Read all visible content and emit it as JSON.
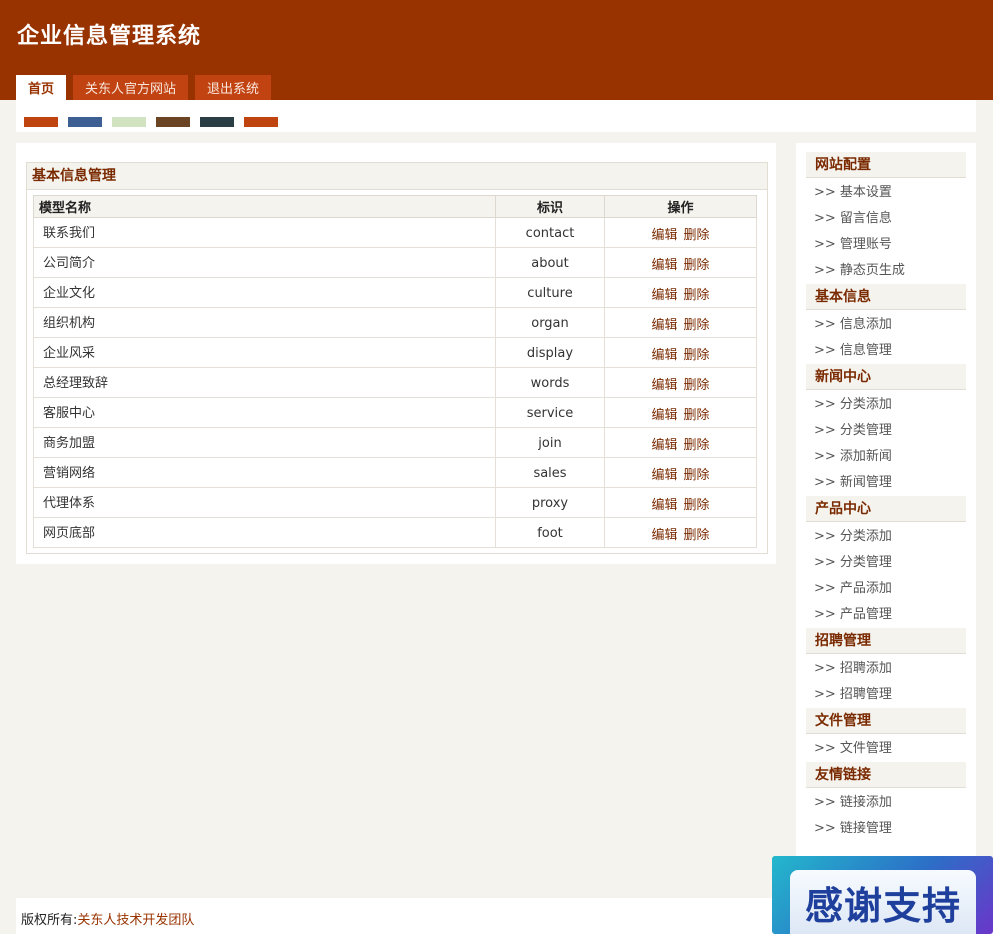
{
  "app": {
    "title": "企业信息管理系统"
  },
  "nav_tabs": [
    {
      "label": "首页",
      "active": true
    },
    {
      "label": "关东人官方网站",
      "active": false
    },
    {
      "label": "退出系统",
      "active": false
    }
  ],
  "theme_swatches": [
    "#c0440f",
    "#3e5f93",
    "#d2e3c2",
    "#6b4423",
    "#2b3e45",
    "#c0440f"
  ],
  "main": {
    "section_title": "基本信息管理",
    "table": {
      "headers": [
        "模型名称",
        "标识",
        "操作"
      ],
      "rows": [
        {
          "name": "联系我们",
          "id": "contact"
        },
        {
          "name": "公司简介",
          "id": "about"
        },
        {
          "name": "企业文化",
          "id": "culture"
        },
        {
          "name": "组织机构",
          "id": "organ"
        },
        {
          "name": "企业风采",
          "id": "display"
        },
        {
          "name": "总经理致辞",
          "id": "words"
        },
        {
          "name": "客服中心",
          "id": "service"
        },
        {
          "name": "商务加盟",
          "id": "join"
        },
        {
          "name": "营销网络",
          "id": "sales"
        },
        {
          "name": "代理体系",
          "id": "proxy"
        },
        {
          "name": "网页底部",
          "id": "foot"
        }
      ],
      "edit_label": "编辑",
      "delete_label": "删除"
    }
  },
  "sidebar": {
    "groups": [
      {
        "title": "网站配置",
        "items": [
          ">> 基本设置",
          ">> 留言信息",
          ">> 管理账号",
          ">> 静态页生成"
        ]
      },
      {
        "title": "基本信息",
        "items": [
          ">> 信息添加",
          ">> 信息管理"
        ]
      },
      {
        "title": "新闻中心",
        "items": [
          ">> 分类添加",
          ">> 分类管理",
          ">> 添加新闻",
          ">> 新闻管理"
        ]
      },
      {
        "title": "产品中心",
        "items": [
          ">> 分类添加",
          ">> 分类管理",
          ">> 产品添加",
          ">> 产品管理"
        ]
      },
      {
        "title": "招聘管理",
        "items": [
          ">> 招聘添加",
          ">> 招聘管理"
        ]
      },
      {
        "title": "文件管理",
        "items": [
          ">> 文件管理"
        ]
      },
      {
        "title": "友情链接",
        "items": [
          ">> 链接添加",
          ">> 链接管理"
        ]
      }
    ]
  },
  "footer": {
    "copyright_prefix": "版权所有:",
    "team": "关东人技术开发团队"
  },
  "badge": {
    "text": "感谢支持"
  }
}
